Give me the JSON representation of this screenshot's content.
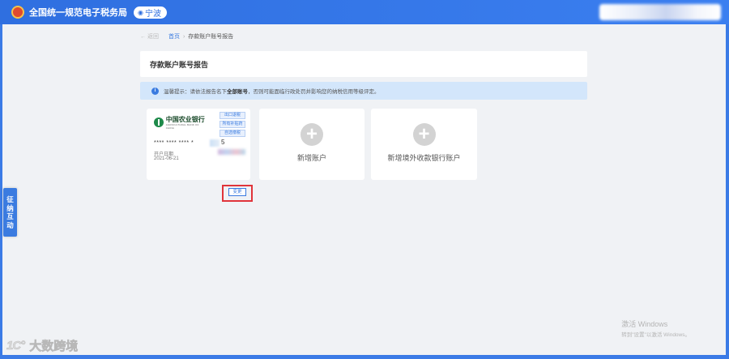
{
  "header": {
    "app_title": "全国统一规范电子税务局",
    "region": "宁波"
  },
  "breadcrumb": {
    "back": "返回",
    "home": "首页",
    "current": "存款账户账号报告"
  },
  "page_title": "存款账户账号报告",
  "notice": {
    "prefix": "温馨提示：请依法报告名下",
    "emphasis": "全部账号",
    "suffix": "，否则可能面临行政处罚并影响您的纳税信用等级评定。"
  },
  "bank_card": {
    "bank_name_cn": "中国农业银行",
    "bank_name_en": "AGRICULTURAL BANK OF CHINA",
    "tags": [
      "出口退税",
      "所有补贴药",
      "自选缴税"
    ],
    "account_masked": "**** **** **** *",
    "account_tail": "5",
    "open_label": "开户日期",
    "open_date": "2021-06-21",
    "change_button": "变更"
  },
  "add_cards": [
    {
      "label": "新增账户"
    },
    {
      "label": "新增境外收款银行账户"
    }
  ],
  "side_tab": {
    "chars": [
      "征",
      "纳",
      "互",
      "动"
    ]
  },
  "watermark": {
    "line1": "激活 Windows",
    "line2": "转到\"设置\"以激活 Windows。"
  },
  "brand": {
    "logo": "1C°",
    "text": "大数跨境"
  },
  "colors": {
    "primary": "#3a7be0",
    "highlight": "#e0343a",
    "notice_bg": "#d3e6fb"
  }
}
